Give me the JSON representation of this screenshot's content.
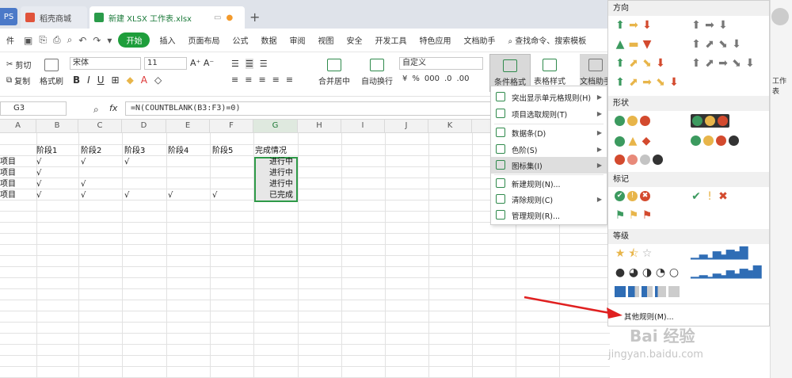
{
  "tabs": {
    "wps": "PS",
    "daoke": "稻壳商城",
    "file": "新建 XLSX 工作表.xlsx"
  },
  "menubar": {
    "file": "件",
    "items": [
      "开始",
      "插入",
      "页面布局",
      "公式",
      "数据",
      "审阅",
      "视图",
      "安全",
      "开发工具",
      "特色应用",
      "文档助手"
    ],
    "search": "查找命令、搜索模板"
  },
  "ribbon": {
    "cut": "剪切",
    "copy": "复制",
    "format_painter": "格式刷",
    "font": "宋体",
    "size": "11",
    "number_format": "自定义",
    "merge": "合并居中",
    "wrap": "自动换行",
    "cond_format": "条件格式",
    "table_style": "表格样式",
    "doc_helper": "文档助手",
    "worksheet": "工作表",
    "percent": "%",
    "ones": "000"
  },
  "formula_bar": {
    "name_box": "G3",
    "fx": "fx",
    "formula": "=N(COUNTBLANK(B3:F3)=0)"
  },
  "columns": [
    "A",
    "B",
    "C",
    "D",
    "E",
    "F",
    "G",
    "H",
    "I",
    "J",
    "K"
  ],
  "rows": [
    [
      "",
      "阶段1",
      "阶段2",
      "阶段3",
      "阶段4",
      "阶段5",
      "完成情况"
    ],
    [
      "项目",
      "√",
      "√",
      "√",
      "",
      "",
      "进行中"
    ],
    [
      "项目",
      "√",
      "",
      "",
      "",
      "",
      "进行中"
    ],
    [
      "项目",
      "√",
      "√",
      "",
      "",
      "",
      "进行中"
    ],
    [
      "项目",
      "√",
      "√",
      "√",
      "√",
      "√",
      "已完成"
    ]
  ],
  "cf_menu": [
    "突出显示单元格规则(H)",
    "项目选取规则(T)",
    "数据条(D)",
    "色阶(S)",
    "图标集(I)",
    "新建规则(N)...",
    "清除规则(C)",
    "管理规则(R)..."
  ],
  "iconsets": {
    "directional": "方向",
    "shapes": "形状",
    "indicators": "标记",
    "ratings": "等级",
    "more": "其他规则(M)..."
  },
  "watermark": {
    "brand": "Bai 经验",
    "url": "jingyan.baidu.com"
  },
  "colors": {
    "accent": "#1e9e3b",
    "green": "#3c9a5f",
    "yellow": "#e8b54a",
    "red": "#d34a2e"
  }
}
